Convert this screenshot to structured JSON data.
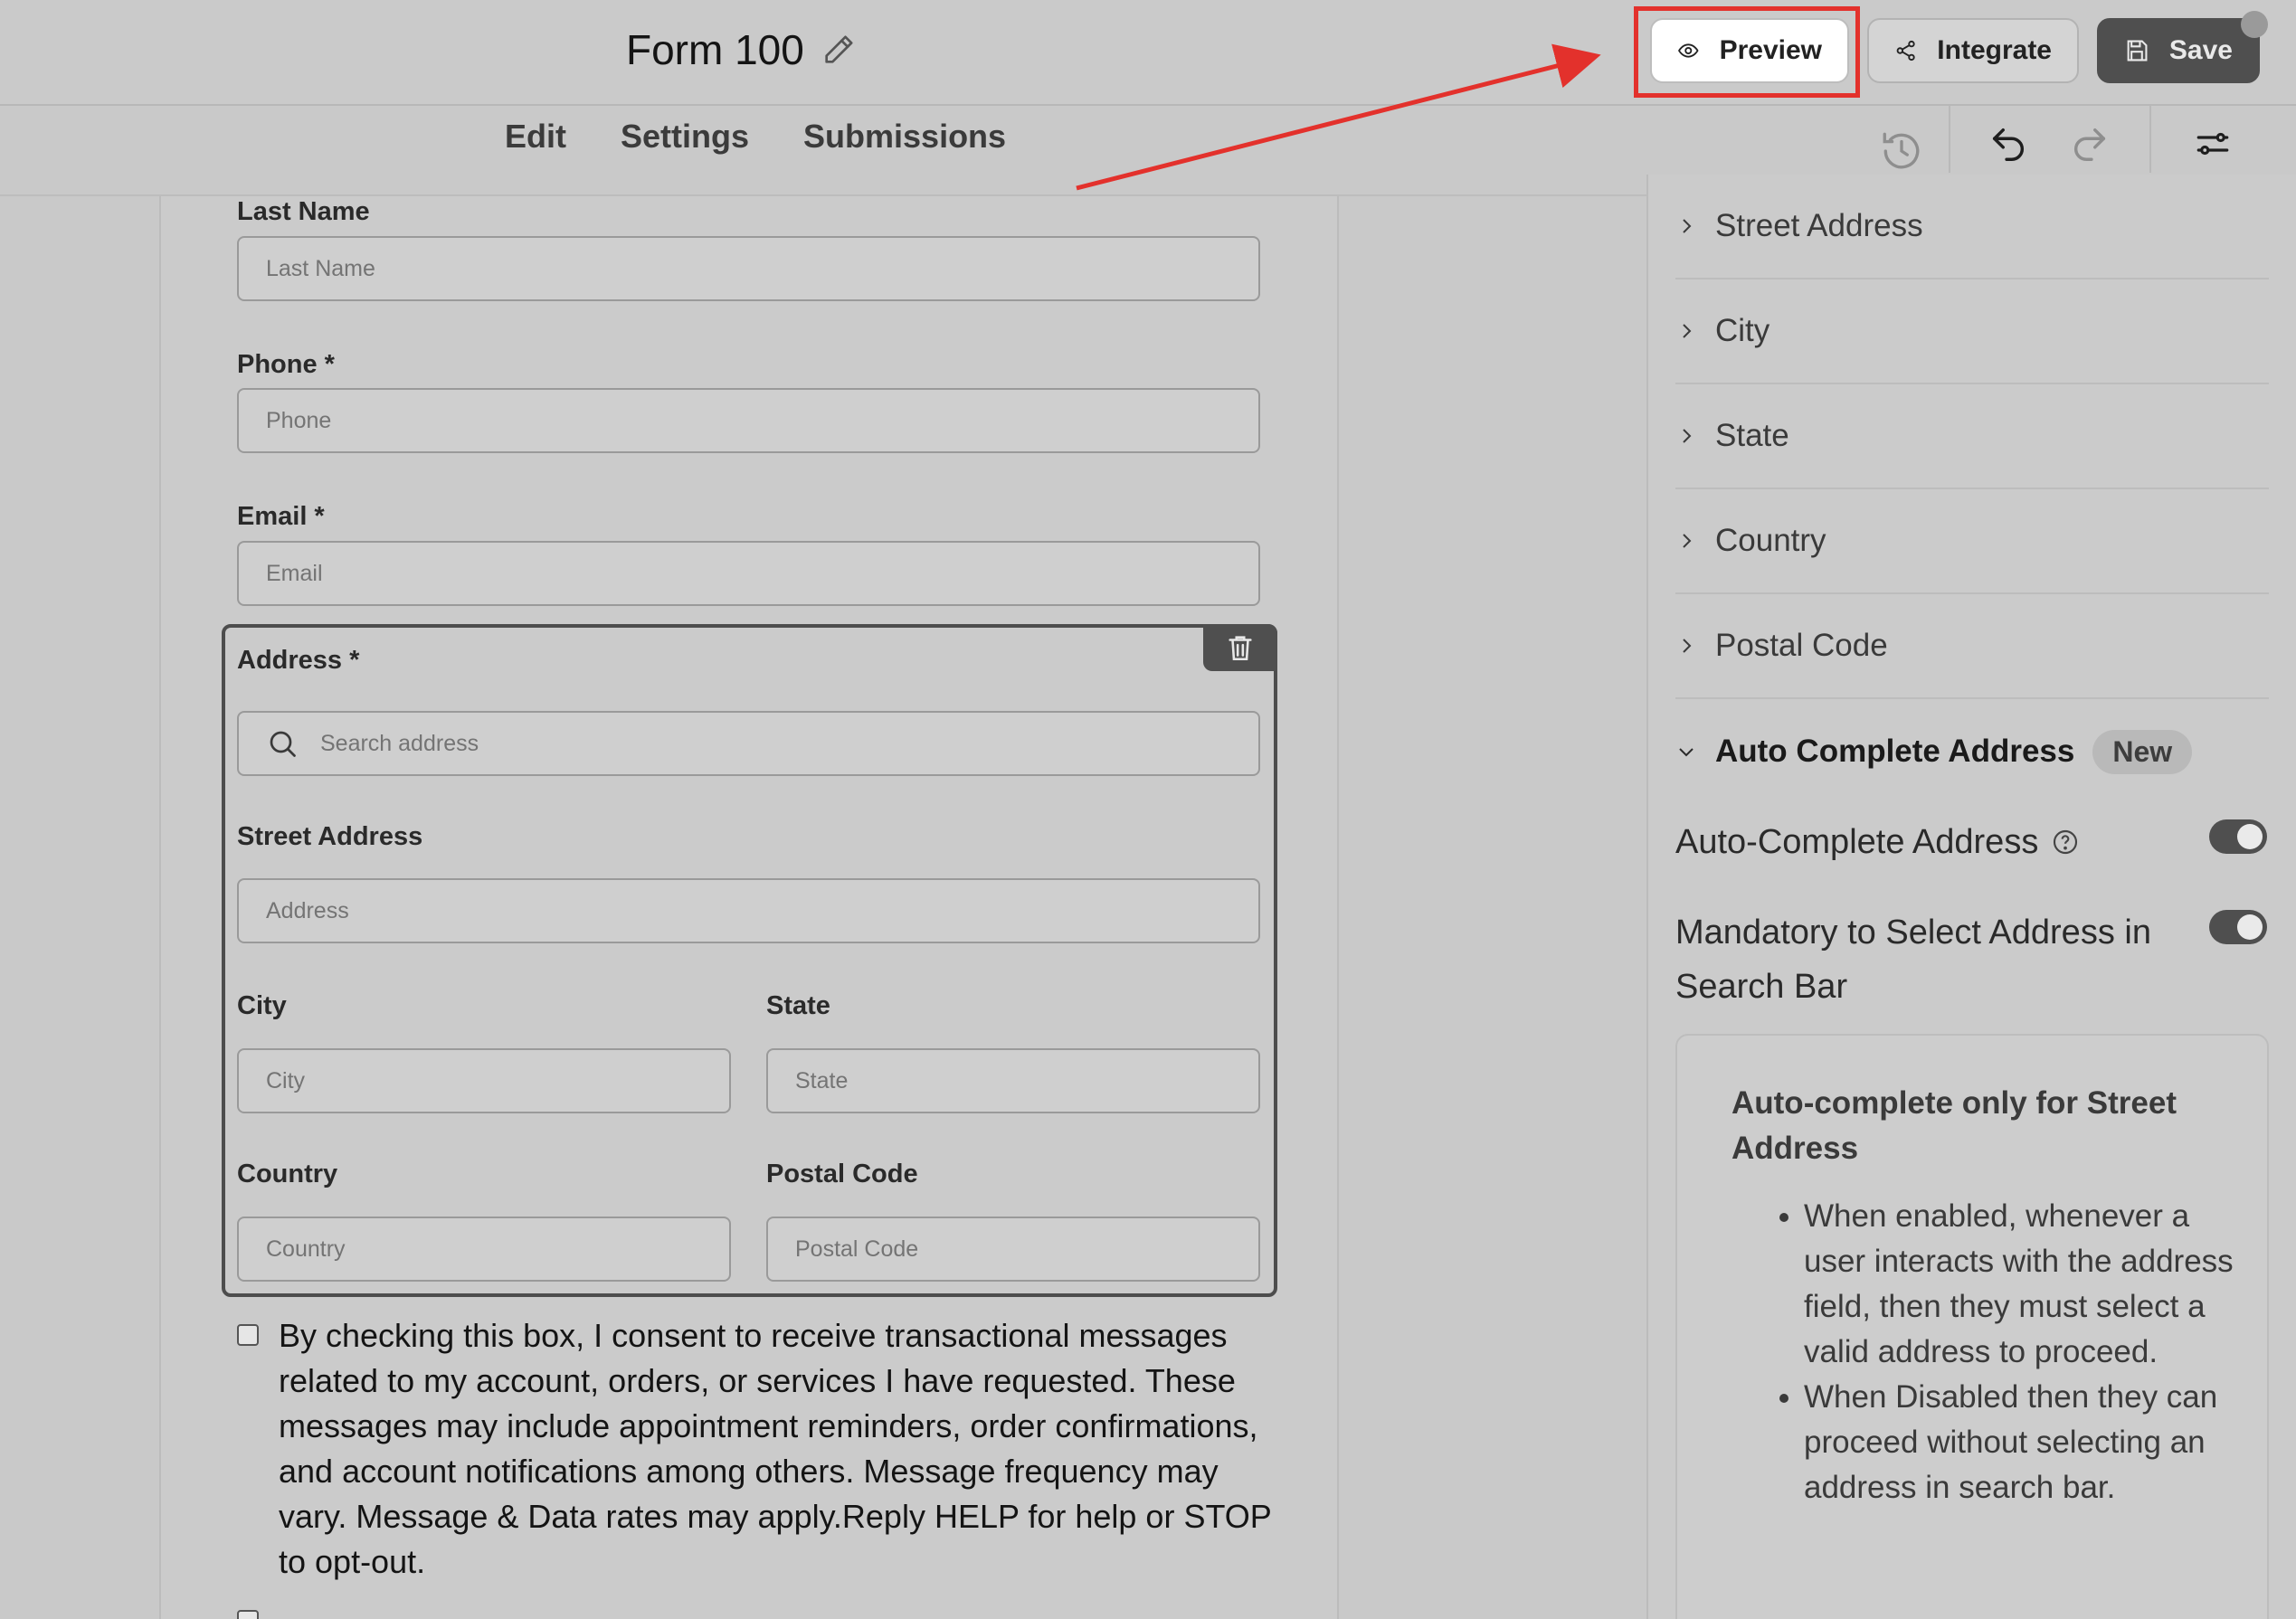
{
  "header": {
    "form_title": "Form 100",
    "preview_label": "Preview",
    "integrate_label": "Integrate",
    "save_label": "Save"
  },
  "tabs": [
    {
      "label": "Edit"
    },
    {
      "label": "Settings"
    },
    {
      "label": "Submissions"
    }
  ],
  "form": {
    "last_name": {
      "label": "Last Name",
      "placeholder": "Last Name"
    },
    "phone": {
      "label": "Phone *",
      "placeholder": "Phone"
    },
    "email": {
      "label": "Email *",
      "placeholder": "Email"
    },
    "address": {
      "label": "Address  *",
      "search_placeholder": "Search address",
      "street": {
        "label": "Street Address",
        "placeholder": "Address"
      },
      "city": {
        "label": "City",
        "placeholder": "City"
      },
      "state": {
        "label": "State",
        "placeholder": "State"
      },
      "country": {
        "label": "Country",
        "placeholder": "Country"
      },
      "postal": {
        "label": "Postal Code",
        "placeholder": "Postal Code"
      }
    },
    "consent_text": "By checking this box, I consent to receive transactional messages related to my account, orders, or services I have requested. These messages may include appointment reminders, order confirmations, and account notifications among others. Message frequency may vary. Message & Data rates may apply.Reply HELP for help or STOP to opt-out."
  },
  "panel": {
    "sections": [
      {
        "label": "Street Address"
      },
      {
        "label": "City"
      },
      {
        "label": "State"
      },
      {
        "label": "Country"
      },
      {
        "label": "Postal Code"
      }
    ],
    "auto_complete_section": {
      "label": "Auto Complete Address",
      "badge": "New"
    },
    "option_autocomplete": {
      "label": "Auto-Complete Address",
      "enabled": true
    },
    "option_mandatory": {
      "line1": "Mandatory to Select Address in",
      "line2": "Search Bar",
      "enabled": true
    },
    "info": {
      "title": "Auto-complete only for Street Address",
      "bullets": [
        "When enabled, whenever a user interacts with the address field, then they must select a valid address to proceed.",
        "When Disabled then they can proceed without selecting an address in search bar."
      ]
    }
  },
  "colors": {
    "highlight": "#e3312c",
    "save_bg": "#4f4f4f",
    "background": "#c9c9c9"
  }
}
